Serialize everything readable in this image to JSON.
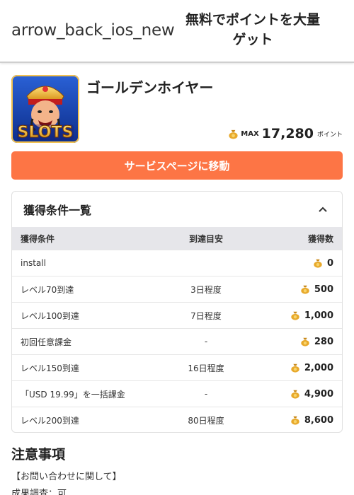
{
  "header": {
    "back_icon_text": "arrow_back_ios_new",
    "title": "無料でポイントを大量ゲット"
  },
  "app": {
    "name": "ゴールデンホイヤー",
    "icon_text": "SLOTS",
    "max_label": "MAX",
    "max_points": "17,280",
    "points_unit": "ポイント"
  },
  "cta": {
    "label": "サービスページに移動"
  },
  "conditions": {
    "title": "獲得条件一覧",
    "columns": [
      "獲得条件",
      "到達目安",
      "獲得数"
    ],
    "rows": [
      {
        "condition": "install",
        "eta": "",
        "points": "0"
      },
      {
        "condition": "レベル70到達",
        "eta": "3日程度",
        "points": "500"
      },
      {
        "condition": "レベル100到達",
        "eta": "7日程度",
        "points": "1,000"
      },
      {
        "condition": "初回任意課金",
        "eta": "-",
        "points": "280"
      },
      {
        "condition": "レベル150到達",
        "eta": "16日程度",
        "points": "2,000"
      },
      {
        "condition": "「USD 19.99」を一括課金",
        "eta": "-",
        "points": "4,900"
      },
      {
        "condition": "レベル200到達",
        "eta": "80日程度",
        "points": "8,600"
      }
    ]
  },
  "notes": {
    "title": "注意事項",
    "lines": [
      "【お問い合わせに関して】",
      "成果調査：可"
    ]
  },
  "colors": {
    "accent": "#fd7545",
    "table_header": "#e6e6ea",
    "coin": "#e8a92b"
  }
}
